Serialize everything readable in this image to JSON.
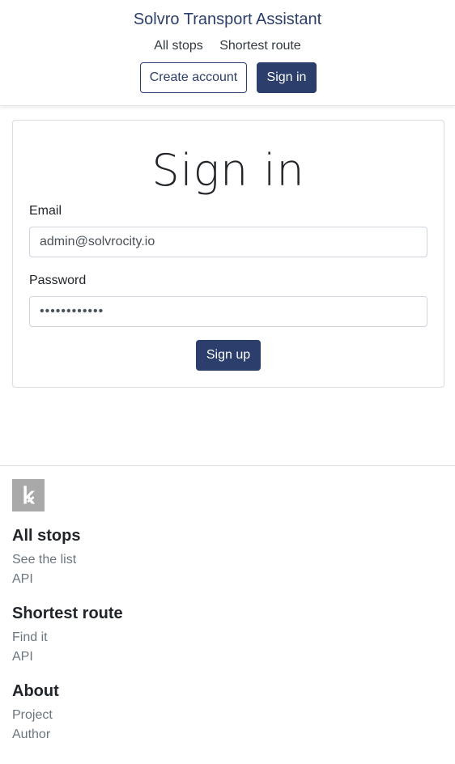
{
  "header": {
    "brand": "Solvro Transport Assistant",
    "nav": [
      "All stops",
      "Shortest route"
    ],
    "create_account_label": "Create account",
    "sign_in_label": "Sign in"
  },
  "form": {
    "title": "Sign in",
    "email_label": "Email",
    "email_value": "admin@solvrocity.io",
    "password_label": "Password",
    "password_value": "••••••••••••",
    "submit_label": "Sign up"
  },
  "footer": {
    "logo_glyph": "ꝃ",
    "sections": [
      {
        "title": "All stops",
        "links": [
          "See the list",
          "API"
        ]
      },
      {
        "title": "Shortest route",
        "links": [
          "Find it",
          "API"
        ]
      },
      {
        "title": "About",
        "links": [
          "Project",
          "Author"
        ]
      }
    ]
  },
  "colors": {
    "primary": "#2c3e6b",
    "muted": "#6c757d",
    "logo_bg": "#a9a9a9"
  }
}
